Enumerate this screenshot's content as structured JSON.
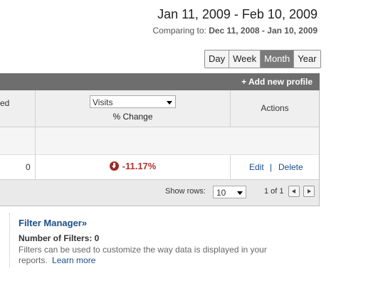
{
  "header": {
    "date_range": "Jan 11, 2009 - Feb 10, 2009",
    "comparing_label": "Comparing to:",
    "comparing_range": "Dec 11, 2008 - Jan 10, 2009"
  },
  "period_buttons": [
    {
      "label": "Day",
      "active": false
    },
    {
      "label": "Week",
      "active": false
    },
    {
      "label": "Month",
      "active": true
    },
    {
      "label": "Year",
      "active": false
    }
  ],
  "profile_bar": {
    "add_profile": "+ Add new profile"
  },
  "table": {
    "col1_header_fragment": "ed",
    "metric_select": "Visits",
    "change_header": "% Change",
    "actions_header": "Actions",
    "row": {
      "value": "0",
      "change": "-11.17%",
      "edit": "Edit",
      "separator": "|",
      "delete": "Delete"
    },
    "footer": {
      "show_rows_label": "Show rows:",
      "rows_value": "10",
      "pager_text": "1 of 1"
    }
  },
  "filter_manager": {
    "title": "Filter Manager»",
    "count_text": "Number of Filters: 0",
    "description": "Filters can be used to customize the way data is displayed in your reports.",
    "learn_more": "Learn more"
  },
  "colors": {
    "negative_change": "#b7312c",
    "link": "#1a4e8a",
    "profile_bar": "#6e6e6e"
  }
}
